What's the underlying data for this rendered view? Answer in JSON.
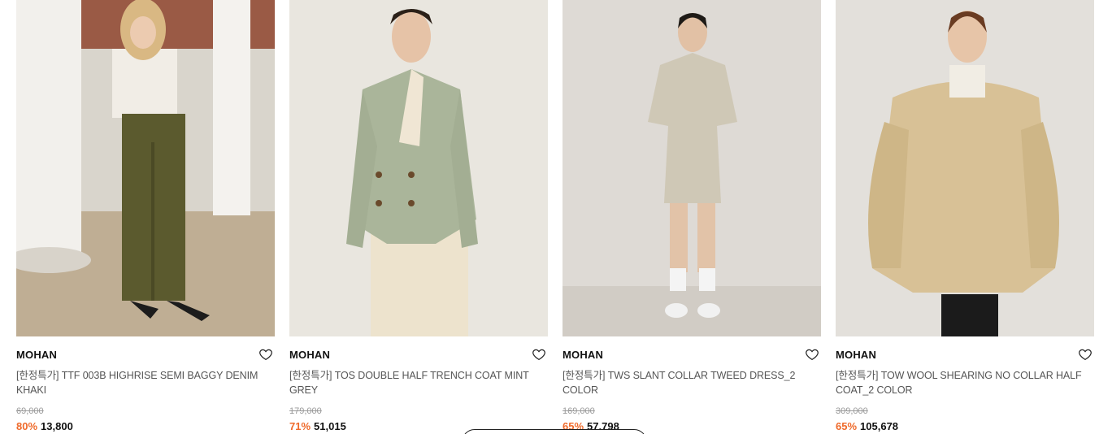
{
  "products": [
    {
      "brand": "MOHAN",
      "name": "[한정특가] TTF 003B HIGHRISE SEMI BAGGY DENIM KHAKI",
      "original_price": "69,000",
      "discount": "80%",
      "price": "13,800",
      "wishlist_icon": "heart-outline-icon"
    },
    {
      "brand": "MOHAN",
      "name": "[한정특가] TOS DOUBLE HALF TRENCH COAT MINT GREY",
      "original_price": "179,000",
      "discount": "71%",
      "price": "51,015",
      "wishlist_icon": "heart-outline-icon"
    },
    {
      "brand": "MOHAN",
      "name": "[한정특가] TWS SLANT COLLAR TWEED DRESS_2 COLOR",
      "original_price": "169,000",
      "discount": "65%",
      "price": "57,798",
      "wishlist_icon": "heart-outline-icon"
    },
    {
      "brand": "MOHAN",
      "name": "[한정특가] TOW WOOL SHEARING NO COLLAR HALF COAT_2 COLOR",
      "original_price": "309,000",
      "discount": "65%",
      "price": "105,678",
      "wishlist_icon": "heart-outline-icon"
    }
  ],
  "colors": {
    "discount": "#ef6a2b",
    "brand_text": "#111111",
    "name_text": "#555555",
    "strike_text": "#9a9a9a"
  }
}
